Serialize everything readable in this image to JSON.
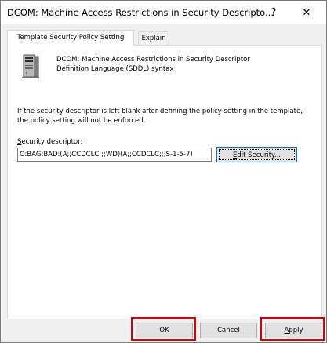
{
  "window": {
    "title": "DCOM: Machine Access Restrictions in Security Descripto...",
    "help_symbol": "?",
    "close_symbol": "✕"
  },
  "tabs": [
    {
      "label": "Template Security Policy Setting",
      "active": true
    },
    {
      "label": "Explain",
      "active": false
    }
  ],
  "policy": {
    "icon": "server-icon",
    "title": "DCOM: Machine Access Restrictions in Security Descriptor\nDefinition Language (SDDL) syntax",
    "info": "If the security descriptor is left blank after defining the policy setting in the template, the policy setting will not be enforced."
  },
  "security_descriptor": {
    "label_underlined": "S",
    "label_rest": "ecurity descriptor:",
    "value": "O:BAG:BAD:(A;;CCDCLC;;;WD)(A;;CCDCLC;;;S-1-5-7)"
  },
  "edit_button": {
    "label_underlined": "E",
    "label_rest": "dit Security..."
  },
  "buttons": {
    "ok": "OK",
    "cancel": "Cancel",
    "apply_underlined": "A",
    "apply_rest": "pply"
  },
  "colors": {
    "highlight": "#e00000",
    "focus_border": "#0078d7"
  }
}
